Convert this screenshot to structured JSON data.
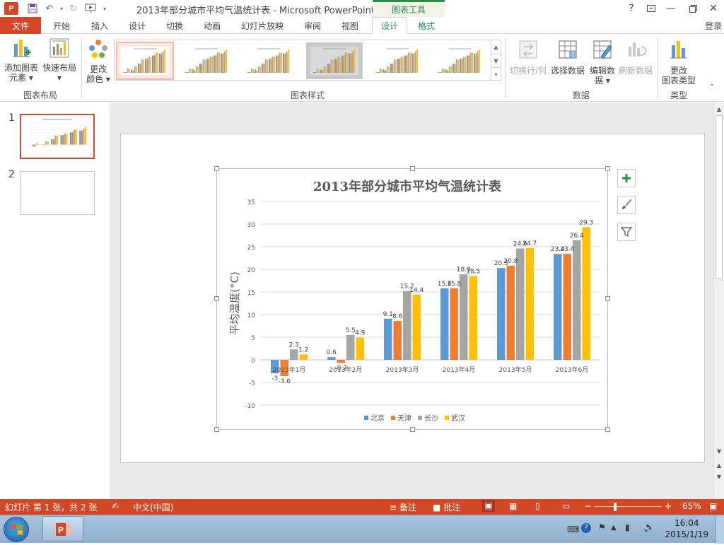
{
  "window": {
    "title": "2013年部分城市平均气温统计表 - Microsoft PowerPoint",
    "context_tab_group": "图表工具",
    "logo": "P"
  },
  "ribbon_tabs": [
    {
      "label": "文件",
      "key": "file"
    },
    {
      "label": "开始"
    },
    {
      "label": "插入"
    },
    {
      "label": "设计"
    },
    {
      "label": "切换"
    },
    {
      "label": "动画"
    },
    {
      "label": "幻灯片放映"
    },
    {
      "label": "审阅"
    },
    {
      "label": "视图"
    },
    {
      "label": "设计",
      "key": "chart-design"
    },
    {
      "label": "格式",
      "key": "chart-format"
    }
  ],
  "login_label": "登录",
  "ribbon": {
    "add_element": [
      "添加图表",
      "元素 ▾"
    ],
    "quick_layout": [
      "快速布局",
      "▾"
    ],
    "change_colors": [
      "更改",
      "颜色 ▾"
    ],
    "switch_row_col": "切换行/列",
    "select_data": "选择数据",
    "edit_data": [
      "编辑数",
      "据 ▾"
    ],
    "refresh_data": "刷新数据",
    "change_type": [
      "更改",
      "图表类型"
    ],
    "groups": {
      "layout": "图表布局",
      "styles": "图表样式",
      "data": "数据",
      "type": "类型"
    }
  },
  "slides": [
    {
      "number": "1"
    },
    {
      "number": "2"
    }
  ],
  "chart_data": {
    "type": "bar",
    "title": "2013年部分城市平均气温统计表",
    "ylabel": "平均温度(°C)",
    "xlabel": "",
    "ylim": [
      -10,
      35
    ],
    "yticks": [
      35,
      30,
      25,
      20,
      15,
      10,
      5,
      0,
      -5,
      -10
    ],
    "categories": [
      "2013年1月",
      "2013年2月",
      "2013年3月",
      "2013年4月",
      "2013年5月",
      "2013年6月"
    ],
    "series": [
      {
        "name": "北京",
        "color": "#5b9bd5",
        "values": [
          -3,
          0.6,
          9.1,
          15.8,
          20.3,
          23.4
        ]
      },
      {
        "name": "天津",
        "color": "#ed7d31",
        "values": [
          -3.6,
          -0.7,
          8.6,
          15.8,
          20.8,
          23.4
        ]
      },
      {
        "name": "长沙",
        "color": "#a5a5a5",
        "values": [
          2.3,
          5.5,
          15.2,
          18.9,
          24.6,
          26.4
        ]
      },
      {
        "name": "武汉",
        "color": "#ffc000",
        "values": [
          1.2,
          4.9,
          14.4,
          18.5,
          24.7,
          29.3
        ]
      }
    ],
    "grid": true,
    "legend_position": "bottom",
    "data_labels": true
  },
  "chart_side_buttons": [
    "plus-icon",
    "brush-icon",
    "filter-icon"
  ],
  "status": {
    "slide_info": "幻灯片 第 1 张，共 2 张",
    "language": "中文(中国)",
    "notes": "备注",
    "comments": "批注",
    "zoom": "65%"
  },
  "taskbar": {
    "time": "16:04",
    "date": "2015/1/19"
  },
  "colors": {
    "accent": "#d24726",
    "context_green": "#2b8d4a"
  }
}
